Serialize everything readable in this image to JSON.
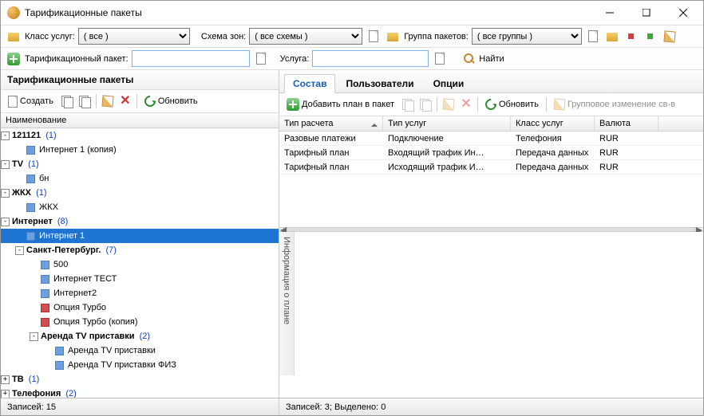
{
  "window": {
    "title": "Тарификационные пакеты"
  },
  "toolbar1": {
    "service_class_label": "Класс услуг:",
    "service_class_value": "( все )",
    "zone_scheme_label": "Схема зон:",
    "zone_scheme_value": "( все схемы )",
    "package_group_label": "Группа пакетов:",
    "package_group_value": "( все группы )"
  },
  "toolbar2": {
    "package_label": "Тарификационный пакет:",
    "package_value": "",
    "service_label": "Услуга:",
    "service_value": "",
    "find_label": "Найти"
  },
  "left": {
    "title": "Тарификационные пакеты",
    "create": "Создать",
    "refresh": "Обновить",
    "column": "Наименование"
  },
  "tree": [
    {
      "depth": 0,
      "exp": "-",
      "parent": true,
      "text": "121121",
      "count": "(1)"
    },
    {
      "depth": 1,
      "icon": "blue",
      "text": "Интернет 1 (копия)"
    },
    {
      "depth": 0,
      "exp": "-",
      "parent": true,
      "text": "TV",
      "count": "(1)"
    },
    {
      "depth": 1,
      "icon": "blue",
      "text": "бн"
    },
    {
      "depth": 0,
      "exp": "-",
      "parent": true,
      "text": "ЖКХ",
      "count": "(1)"
    },
    {
      "depth": 1,
      "icon": "blue",
      "text": "ЖКХ"
    },
    {
      "depth": 0,
      "exp": "-",
      "parent": true,
      "text": "Интернет",
      "count": "(8)"
    },
    {
      "depth": 1,
      "icon": "blue",
      "text": "Интернет 1",
      "sel": true
    },
    {
      "depth": 1,
      "exp": "-",
      "parent": true,
      "text": "Санкт-Петербург.",
      "count": "(7)"
    },
    {
      "depth": 2,
      "icon": "blue",
      "text": "500"
    },
    {
      "depth": 2,
      "icon": "blue",
      "text": "Интернет ТЕСТ"
    },
    {
      "depth": 2,
      "icon": "blue",
      "text": "Интернет2"
    },
    {
      "depth": 2,
      "icon": "red",
      "text": "Опция Турбо"
    },
    {
      "depth": 2,
      "icon": "red",
      "text": "Опция Турбо (копия)"
    },
    {
      "depth": 2,
      "exp": "-",
      "parent": true,
      "text": "Аренда TV приставки",
      "count": "(2)"
    },
    {
      "depth": 3,
      "icon": "blue",
      "text": "Аренда TV приставки"
    },
    {
      "depth": 3,
      "icon": "blue",
      "text": "Аренда TV приставки ФИЗ"
    },
    {
      "depth": 0,
      "exp": "+",
      "parent": true,
      "text": "ТВ",
      "count": "(1)"
    },
    {
      "depth": 0,
      "exp": "+",
      "parent": true,
      "text": "Телефония",
      "count": "(2)"
    }
  ],
  "tabs": {
    "t1": "Состав",
    "t2": "Пользователи",
    "t3": "Опции"
  },
  "right_tb": {
    "add_plan": "Добавить план в пакет",
    "refresh": "Обновить",
    "group_edit": "Групповое изменение св-в"
  },
  "grid": {
    "headers": {
      "c1": "Тип расчета",
      "c2": "Тип услуг",
      "c3": "Класс услуг",
      "c4": "Валюта"
    },
    "rows": [
      {
        "c1": "Разовые платежи",
        "c2": "Подключение",
        "c3": "Телефония",
        "c4": "RUR"
      },
      {
        "c1": "Тарифный план",
        "c2": "Входящий трафик Ин…",
        "c3": "Передача данных",
        "c4": "RUR"
      },
      {
        "c1": "Тарифный план",
        "c2": "Исходящий трафик И…",
        "c3": "Передача данных",
        "c4": "RUR"
      }
    ]
  },
  "info_label": "Информация о плане",
  "status": {
    "left": "Записей: 15",
    "right": "Записей: 3; Выделено: 0"
  }
}
